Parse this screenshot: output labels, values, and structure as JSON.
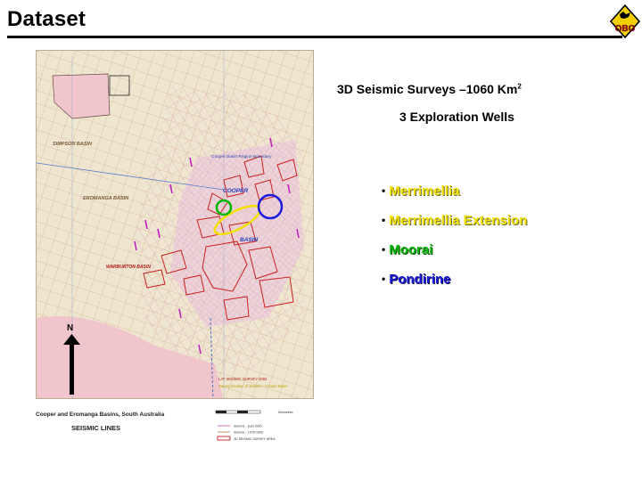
{
  "slide": {
    "title": "Dataset"
  },
  "logo": {
    "text": "OBO"
  },
  "map": {
    "labels": {
      "simpson": "SIMPSON BASIN",
      "eromanga": "EROMANGA BASIN",
      "warburton": "WARBURTON BASIN",
      "cooper": "COOPER",
      "basin": "BASIN",
      "cooper_region": "Cooper Basin Region Boundary",
      "north": "N",
      "legend_small1": "LAT SEISMIC SURVEY 2002",
      "legend_small2": "Survey location of seismic - Cooper Basin"
    },
    "legend": {
      "title": "Cooper and Eromanga Basins, South Australia",
      "subtitle": "SEISMIC LINES",
      "scale_label": "Kilometres",
      "items": [
        "Seismic - post 2000",
        "Seismic - 1976-1999",
        "3D SEISMIC SURVEY AREA"
      ]
    }
  },
  "stats": {
    "surveys_text": "3D Seismic Surveys –1060 Km",
    "surveys_sup": "2",
    "wells_text": "3 Exploration Wells"
  },
  "wells": [
    {
      "bullet": "•",
      "name": "Merrimellia"
    },
    {
      "bullet": "•",
      "name": "Merrimellia Extension"
    },
    {
      "bullet": "•",
      "name": "Moorai"
    },
    {
      "bullet": "•",
      "name": "Pondirine"
    }
  ],
  "colors": {
    "yellow": "#f2e100",
    "green": "#00b800",
    "blue": "#1a1adc",
    "survey_red": "#cc2020",
    "seismic_pink": "#d88ac8"
  }
}
